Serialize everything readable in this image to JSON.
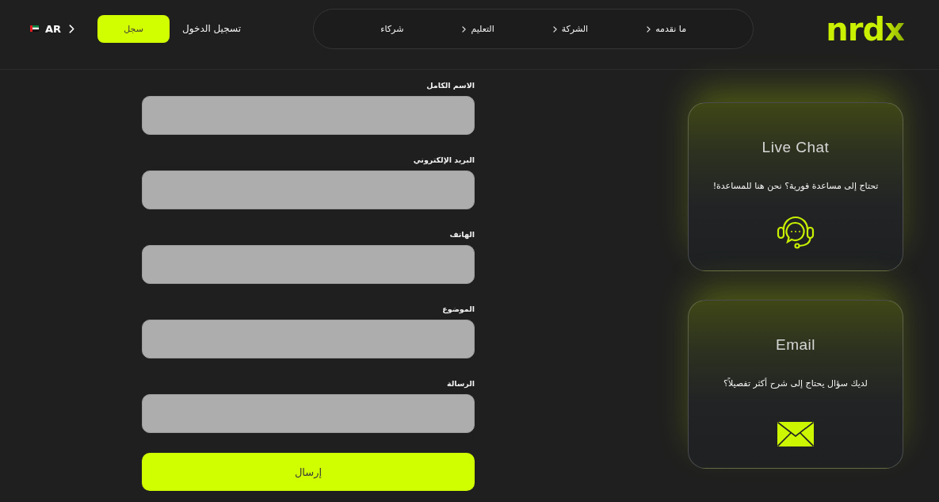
{
  "header": {
    "logo": "nrdx",
    "nav": [
      {
        "label": "ما نقدمه",
        "dropdown": true
      },
      {
        "label": "الشركة",
        "dropdown": true
      },
      {
        "label": "التعليم",
        "dropdown": true
      },
      {
        "label": "شركاء",
        "dropdown": false
      }
    ],
    "login": "تسجيل الدخول",
    "register": "سجل",
    "language": "AR"
  },
  "contact_form": {
    "fields": [
      {
        "label": "الاسم الكامل"
      },
      {
        "label": "البريد الإلكتروني"
      },
      {
        "label": "الهاتف"
      },
      {
        "label": "الموضوع"
      },
      {
        "label": "الرسالة"
      }
    ],
    "submit": "إرسال"
  },
  "cards": [
    {
      "kind": "chat",
      "title": "Live Chat",
      "text": "تحتاج إلى مساعدة فورية؟ نحن هنا للمساعدة!"
    },
    {
      "kind": "email",
      "title": "Email",
      "text": "لديك سؤال يحتاج إلى شرح أكثر تفصيلاً؟"
    }
  ]
}
